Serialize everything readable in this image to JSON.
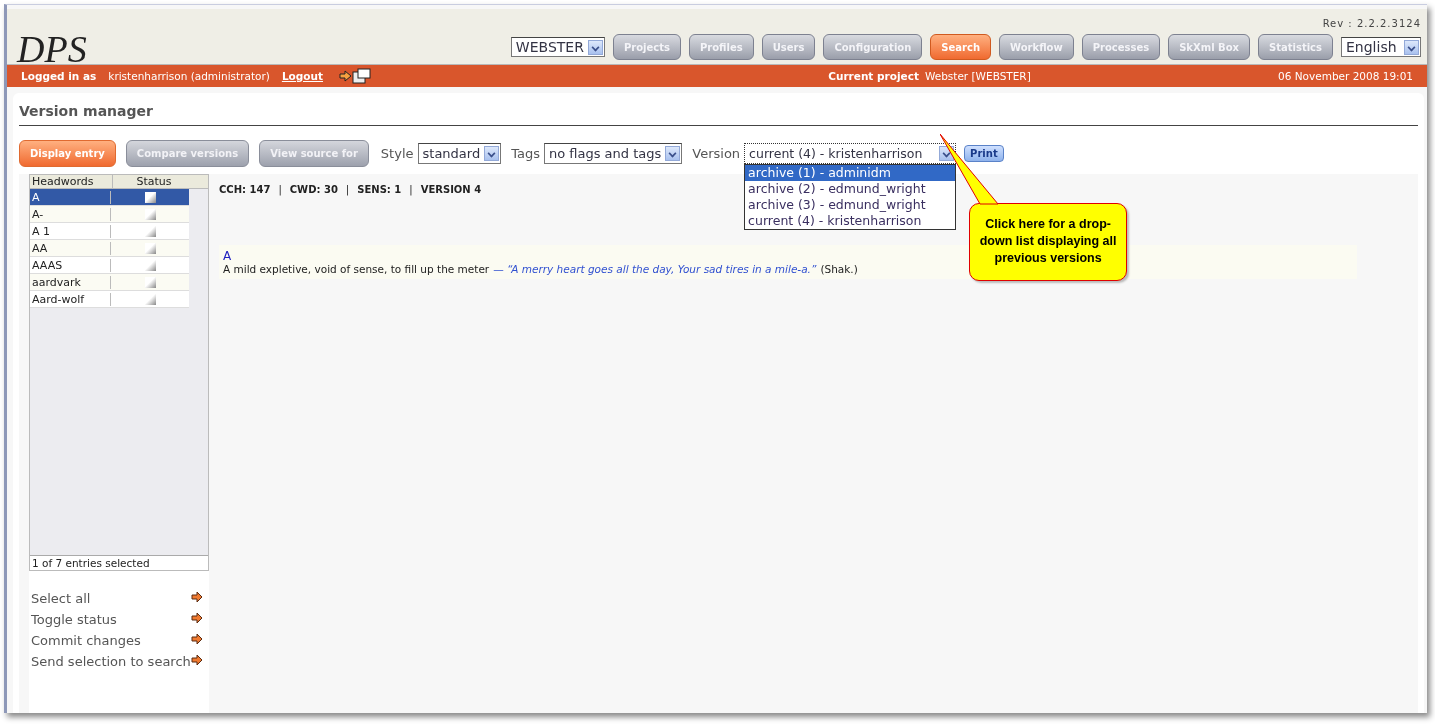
{
  "header": {
    "logo": "DPS",
    "revision": "Rev : 2.2.2.3124",
    "project_select": "WEBSTER",
    "language_select": "English"
  },
  "nav": [
    {
      "label": "Projects",
      "selected": false
    },
    {
      "label": "Profiles",
      "selected": false
    },
    {
      "label": "Users",
      "selected": false
    },
    {
      "label": "Configuration",
      "selected": false
    },
    {
      "label": "Search",
      "selected": true
    },
    {
      "label": "Workflow",
      "selected": false
    },
    {
      "label": "Processes",
      "selected": false
    },
    {
      "label": "SkXml Box",
      "selected": false
    },
    {
      "label": "Statistics",
      "selected": false
    }
  ],
  "status_bar": {
    "logged_label": "Logged in as",
    "user": "kristenharrison (administrator)",
    "logout": "Logout",
    "project_label": "Current project",
    "project": "Webster [WEBSTER]",
    "date": "06 November 2008 19:01"
  },
  "page_title": "Version manager",
  "actions": [
    {
      "label": "Display entry",
      "selected": true
    },
    {
      "label": "Compare versions",
      "selected": false
    },
    {
      "label": "View source for",
      "selected": false
    }
  ],
  "filters": {
    "style_label": "Style",
    "style": "standard",
    "tags_label": "Tags",
    "tags": "no flags and tags",
    "version_label": "Version",
    "version": "current (4) - kristenharrison",
    "print": "Print"
  },
  "version_options": [
    {
      "label": "archive (1) - adminidm",
      "selected": true
    },
    {
      "label": "archive (2) - edmund_wright",
      "selected": false
    },
    {
      "label": "archive (3) - edmund_wright",
      "selected": false
    },
    {
      "label": "current (4) - kristenharrison",
      "selected": false
    }
  ],
  "table": {
    "columns": [
      "Headwords",
      "Status"
    ],
    "rows": [
      {
        "headword": "A",
        "selected": true
      },
      {
        "headword": "A-",
        "selected": false
      },
      {
        "headword": "A 1",
        "selected": false
      },
      {
        "headword": "AA",
        "selected": false
      },
      {
        "headword": "AAAS",
        "selected": false
      },
      {
        "headword": "aardvark",
        "selected": false
      },
      {
        "headword": "Aard-wolf",
        "selected": false
      }
    ],
    "footer": "1 of 7 entries selected"
  },
  "side_actions": [
    "Select all",
    "Toggle status",
    "Commit changes",
    "Send selection to search"
  ],
  "entry": {
    "separator": "|",
    "stats": [
      {
        "label": "CCH:",
        "value": "147"
      },
      {
        "label": "CWD:",
        "value": "30"
      },
      {
        "label": "SENS:",
        "value": "1"
      },
      {
        "label": "VERSION",
        "value": "4"
      }
    ],
    "headword": "A",
    "definition": "A mild expletive, void of sense, to fill up the meter",
    "dash": "—",
    "quote": "“A merry heart goes all the day, Your sad tires in a mile-a.”",
    "source": "(Shak.)"
  },
  "callout": "Click here for a drop-down list displaying all previous versions"
}
